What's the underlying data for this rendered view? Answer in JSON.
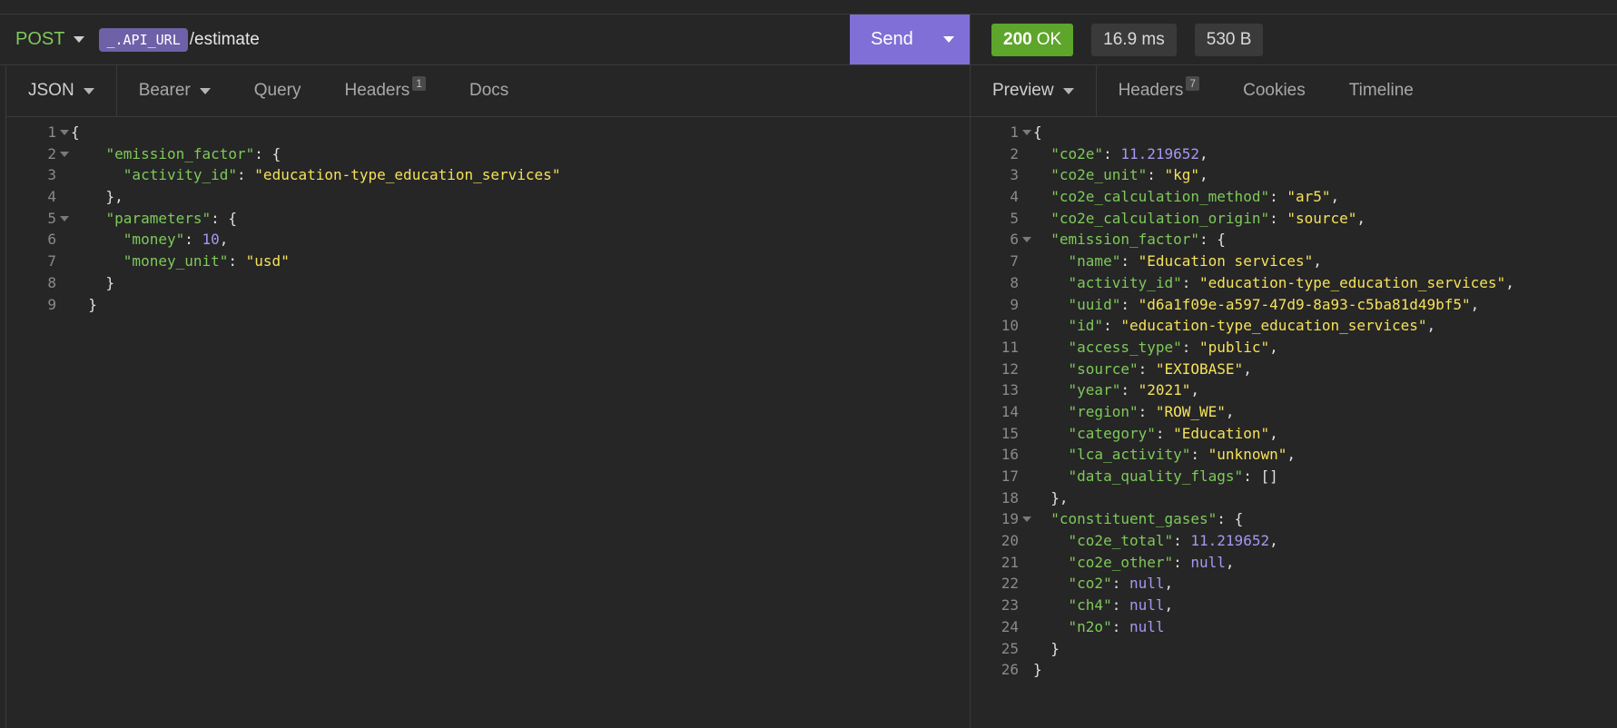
{
  "request": {
    "method": "POST",
    "url_env_tag": "_.API_URL",
    "url_path": "/estimate",
    "send_label": "Send"
  },
  "response_status": {
    "code": "200",
    "text": "OK",
    "time": "16.9 ms",
    "size": "530 B"
  },
  "request_tabs": {
    "body": "JSON",
    "auth": "Bearer",
    "query": "Query",
    "headers": "Headers",
    "headers_count": "1",
    "docs": "Docs"
  },
  "response_tabs": {
    "preview": "Preview",
    "headers": "Headers",
    "headers_count": "7",
    "cookies": "Cookies",
    "timeline": "Timeline"
  },
  "colors": {
    "key": "#7ec95a",
    "string": "#f5e15a",
    "number": "#a896f2",
    "send_button": "#7f6fd6",
    "status_ok": "#5ea52b"
  },
  "request_body": [
    {
      "n": "1",
      "fold": true,
      "t": [
        [
          "p",
          "{"
        ]
      ]
    },
    {
      "n": "2",
      "fold": true,
      "t": [
        [
          "p",
          "    "
        ],
        [
          "k",
          "\"emission_factor\""
        ],
        [
          "p",
          ": {"
        ]
      ]
    },
    {
      "n": "3",
      "fold": false,
      "t": [
        [
          "p",
          "      "
        ],
        [
          "k",
          "\"activity_id\""
        ],
        [
          "p",
          ": "
        ],
        [
          "s",
          "\"education-type_education_services\""
        ]
      ]
    },
    {
      "n": "4",
      "fold": false,
      "t": [
        [
          "p",
          "    },"
        ]
      ]
    },
    {
      "n": "5",
      "fold": true,
      "t": [
        [
          "p",
          "    "
        ],
        [
          "k",
          "\"parameters\""
        ],
        [
          "p",
          ": {"
        ]
      ]
    },
    {
      "n": "6",
      "fold": false,
      "t": [
        [
          "p",
          "      "
        ],
        [
          "k",
          "\"money\""
        ],
        [
          "p",
          ": "
        ],
        [
          "n",
          "10"
        ],
        [
          "p",
          ","
        ]
      ]
    },
    {
      "n": "7",
      "fold": false,
      "t": [
        [
          "p",
          "      "
        ],
        [
          "k",
          "\"money_unit\""
        ],
        [
          "p",
          ": "
        ],
        [
          "s",
          "\"usd\""
        ]
      ]
    },
    {
      "n": "8",
      "fold": false,
      "t": [
        [
          "p",
          "    }"
        ]
      ]
    },
    {
      "n": "9",
      "fold": false,
      "t": [
        [
          "p",
          "  }"
        ]
      ]
    }
  ],
  "response_body": [
    {
      "n": "1",
      "fold": true,
      "t": [
        [
          "p",
          "{"
        ]
      ]
    },
    {
      "n": "2",
      "fold": false,
      "t": [
        [
          "p",
          "  "
        ],
        [
          "k",
          "\"co2e\""
        ],
        [
          "p",
          ": "
        ],
        [
          "n",
          "11.219652"
        ],
        [
          "p",
          ","
        ]
      ]
    },
    {
      "n": "3",
      "fold": false,
      "t": [
        [
          "p",
          "  "
        ],
        [
          "k",
          "\"co2e_unit\""
        ],
        [
          "p",
          ": "
        ],
        [
          "s",
          "\"kg\""
        ],
        [
          "p",
          ","
        ]
      ]
    },
    {
      "n": "4",
      "fold": false,
      "t": [
        [
          "p",
          "  "
        ],
        [
          "k",
          "\"co2e_calculation_method\""
        ],
        [
          "p",
          ": "
        ],
        [
          "s",
          "\"ar5\""
        ],
        [
          "p",
          ","
        ]
      ]
    },
    {
      "n": "5",
      "fold": false,
      "t": [
        [
          "p",
          "  "
        ],
        [
          "k",
          "\"co2e_calculation_origin\""
        ],
        [
          "p",
          ": "
        ],
        [
          "s",
          "\"source\""
        ],
        [
          "p",
          ","
        ]
      ]
    },
    {
      "n": "6",
      "fold": true,
      "t": [
        [
          "p",
          "  "
        ],
        [
          "k",
          "\"emission_factor\""
        ],
        [
          "p",
          ": {"
        ]
      ]
    },
    {
      "n": "7",
      "fold": false,
      "t": [
        [
          "p",
          "    "
        ],
        [
          "k",
          "\"name\""
        ],
        [
          "p",
          ": "
        ],
        [
          "s",
          "\"Education services\""
        ],
        [
          "p",
          ","
        ]
      ]
    },
    {
      "n": "8",
      "fold": false,
      "t": [
        [
          "p",
          "    "
        ],
        [
          "k",
          "\"activity_id\""
        ],
        [
          "p",
          ": "
        ],
        [
          "s",
          "\"education-type_education_services\""
        ],
        [
          "p",
          ","
        ]
      ]
    },
    {
      "n": "9",
      "fold": false,
      "t": [
        [
          "p",
          "    "
        ],
        [
          "k",
          "\"uuid\""
        ],
        [
          "p",
          ": "
        ],
        [
          "s",
          "\"d6a1f09e-a597-47d9-8a93-c5ba81d49bf5\""
        ],
        [
          "p",
          ","
        ]
      ]
    },
    {
      "n": "10",
      "fold": false,
      "t": [
        [
          "p",
          "    "
        ],
        [
          "k",
          "\"id\""
        ],
        [
          "p",
          ": "
        ],
        [
          "s",
          "\"education-type_education_services\""
        ],
        [
          "p",
          ","
        ]
      ]
    },
    {
      "n": "11",
      "fold": false,
      "t": [
        [
          "p",
          "    "
        ],
        [
          "k",
          "\"access_type\""
        ],
        [
          "p",
          ": "
        ],
        [
          "s",
          "\"public\""
        ],
        [
          "p",
          ","
        ]
      ]
    },
    {
      "n": "12",
      "fold": false,
      "t": [
        [
          "p",
          "    "
        ],
        [
          "k",
          "\"source\""
        ],
        [
          "p",
          ": "
        ],
        [
          "s",
          "\"EXIOBASE\""
        ],
        [
          "p",
          ","
        ]
      ]
    },
    {
      "n": "13",
      "fold": false,
      "t": [
        [
          "p",
          "    "
        ],
        [
          "k",
          "\"year\""
        ],
        [
          "p",
          ": "
        ],
        [
          "s",
          "\"2021\""
        ],
        [
          "p",
          ","
        ]
      ]
    },
    {
      "n": "14",
      "fold": false,
      "t": [
        [
          "p",
          "    "
        ],
        [
          "k",
          "\"region\""
        ],
        [
          "p",
          ": "
        ],
        [
          "s",
          "\"ROW_WE\""
        ],
        [
          "p",
          ","
        ]
      ]
    },
    {
      "n": "15",
      "fold": false,
      "t": [
        [
          "p",
          "    "
        ],
        [
          "k",
          "\"category\""
        ],
        [
          "p",
          ": "
        ],
        [
          "s",
          "\"Education\""
        ],
        [
          "p",
          ","
        ]
      ]
    },
    {
      "n": "16",
      "fold": false,
      "t": [
        [
          "p",
          "    "
        ],
        [
          "k",
          "\"lca_activity\""
        ],
        [
          "p",
          ": "
        ],
        [
          "s",
          "\"unknown\""
        ],
        [
          "p",
          ","
        ]
      ]
    },
    {
      "n": "17",
      "fold": false,
      "t": [
        [
          "p",
          "    "
        ],
        [
          "k",
          "\"data_quality_flags\""
        ],
        [
          "p",
          ": []"
        ]
      ]
    },
    {
      "n": "18",
      "fold": false,
      "t": [
        [
          "p",
          "  },"
        ]
      ]
    },
    {
      "n": "19",
      "fold": true,
      "t": [
        [
          "p",
          "  "
        ],
        [
          "k",
          "\"constituent_gases\""
        ],
        [
          "p",
          ": {"
        ]
      ]
    },
    {
      "n": "20",
      "fold": false,
      "t": [
        [
          "p",
          "    "
        ],
        [
          "k",
          "\"co2e_total\""
        ],
        [
          "p",
          ": "
        ],
        [
          "n",
          "11.219652"
        ],
        [
          "p",
          ","
        ]
      ]
    },
    {
      "n": "21",
      "fold": false,
      "t": [
        [
          "p",
          "    "
        ],
        [
          "k",
          "\"co2e_other\""
        ],
        [
          "p",
          ": "
        ],
        [
          "n",
          "null"
        ],
        [
          "p",
          ","
        ]
      ]
    },
    {
      "n": "22",
      "fold": false,
      "t": [
        [
          "p",
          "    "
        ],
        [
          "k",
          "\"co2\""
        ],
        [
          "p",
          ": "
        ],
        [
          "n",
          "null"
        ],
        [
          "p",
          ","
        ]
      ]
    },
    {
      "n": "23",
      "fold": false,
      "t": [
        [
          "p",
          "    "
        ],
        [
          "k",
          "\"ch4\""
        ],
        [
          "p",
          ": "
        ],
        [
          "n",
          "null"
        ],
        [
          "p",
          ","
        ]
      ]
    },
    {
      "n": "24",
      "fold": false,
      "t": [
        [
          "p",
          "    "
        ],
        [
          "k",
          "\"n2o\""
        ],
        [
          "p",
          ": "
        ],
        [
          "n",
          "null"
        ]
      ]
    },
    {
      "n": "25",
      "fold": false,
      "t": [
        [
          "p",
          "  }"
        ]
      ]
    },
    {
      "n": "26",
      "fold": false,
      "t": [
        [
          "p",
          "}"
        ]
      ]
    }
  ]
}
